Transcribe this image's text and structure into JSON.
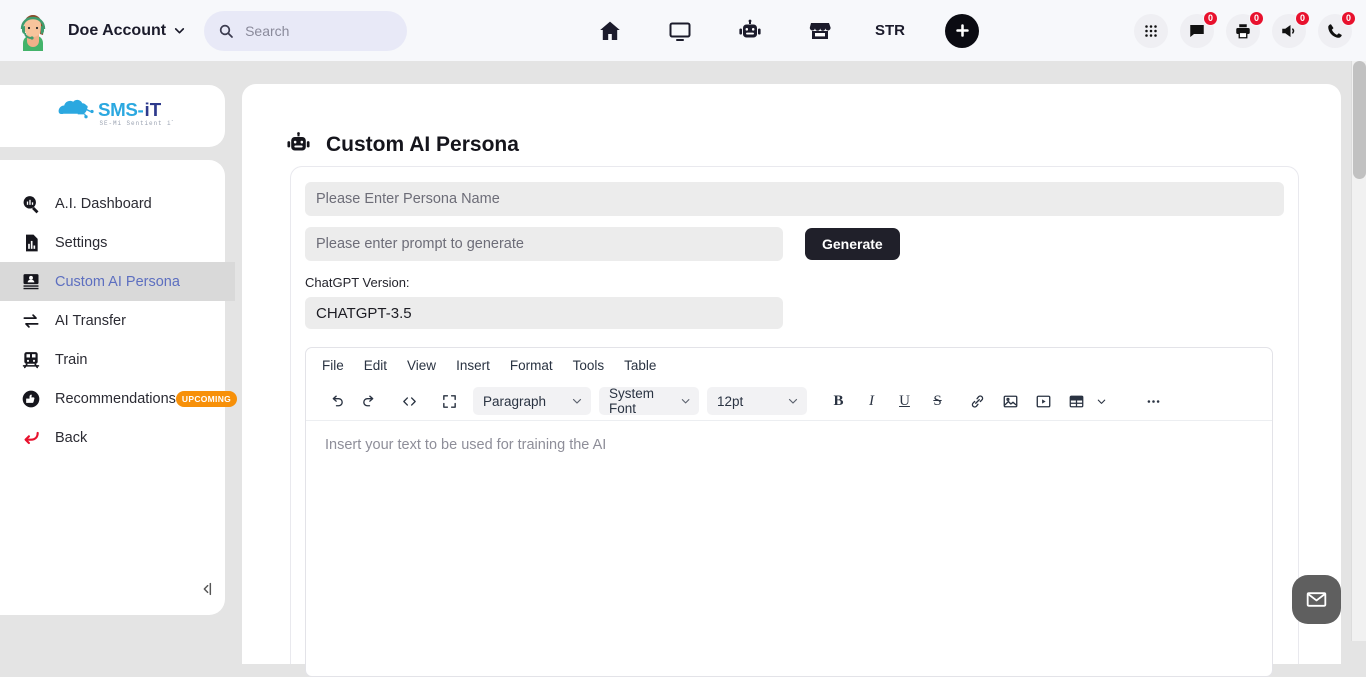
{
  "topbar": {
    "avatar": "user-avatar-headset",
    "account_name": "Doe Account",
    "account_chevron": "chevron-down-icon",
    "search": {
      "placeholder": "Search",
      "value": "",
      "icon": "search-icon"
    },
    "center_nav": [
      {
        "name": "home",
        "icon": "home-icon",
        "label": ""
      },
      {
        "name": "desktop",
        "icon": "monitor-icon",
        "label": ""
      },
      {
        "name": "ai-robot",
        "icon": "robot-icon",
        "label": ""
      },
      {
        "name": "store",
        "icon": "store-icon",
        "label": ""
      },
      {
        "name": "str",
        "icon": "",
        "label": "STR"
      }
    ],
    "add_button": {
      "icon": "plus-icon",
      "label": ""
    },
    "right_nav": [
      {
        "name": "apps",
        "icon": "grid-dots-icon",
        "badge": ""
      },
      {
        "name": "messages",
        "icon": "chat-bubble-icon",
        "badge": "0"
      },
      {
        "name": "fax",
        "icon": "printer-icon",
        "badge": "0"
      },
      {
        "name": "campaigns",
        "icon": "megaphone-icon",
        "badge": "0"
      },
      {
        "name": "calls",
        "icon": "phone-icon",
        "badge": "0"
      }
    ]
  },
  "sidebar": {
    "logo": {
      "title": "SMS-iT",
      "tagline": "SE-Mi Sentient iT"
    },
    "items": [
      {
        "label": "A.I. Dashboard",
        "icon": "dashboard-search-icon",
        "active": false,
        "badge": ""
      },
      {
        "label": "Settings",
        "icon": "report-settings-icon",
        "active": false,
        "badge": ""
      },
      {
        "label": "Custom AI Persona",
        "icon": "persona-card-icon",
        "active": true,
        "badge": ""
      },
      {
        "label": "AI Transfer",
        "icon": "transfer-arrows-icon",
        "active": false,
        "badge": ""
      },
      {
        "label": "Train",
        "icon": "train-icon",
        "active": false,
        "badge": ""
      },
      {
        "label": "Recommendations",
        "icon": "thumbs-up-icon",
        "active": false,
        "badge": "UPCOMING"
      },
      {
        "label": "Back",
        "icon": "back-arrow-icon",
        "active": false,
        "badge": ""
      }
    ],
    "collapse": {
      "icon": "collapse-sidebar-icon"
    }
  },
  "main": {
    "title": "Custom AI Persona",
    "title_icon": "robot-icon",
    "persona_name": {
      "placeholder": "Please Enter Persona Name",
      "value": ""
    },
    "prompt": {
      "placeholder": "Please enter prompt to generate",
      "value": ""
    },
    "generate_label": "Generate",
    "version_label": "ChatGPT Version:",
    "version_value": "CHATGPT-3.5",
    "editor": {
      "menus": [
        "File",
        "Edit",
        "View",
        "Insert",
        "Format",
        "Tools",
        "Table"
      ],
      "toolbar": {
        "undo": "undo-icon",
        "redo": "redo-icon",
        "source_code": "source-code-icon",
        "fullscreen": "fullscreen-icon",
        "block_format": "Paragraph",
        "font_family": "System Font",
        "font_size": "12pt",
        "bold": "B",
        "italic": "I",
        "underline": "U",
        "strikethrough": "S",
        "link": "link-icon",
        "image": "image-icon",
        "media": "media-icon",
        "table": "table-icon",
        "more": "more-options-icon"
      },
      "placeholder": "Insert your text to be used for training the AI"
    }
  },
  "fab": {
    "icon": "mail-icon",
    "label": ""
  },
  "colors": {
    "accent_blue": "#5d6fc0",
    "badge_red": "#e8112d",
    "upcoming_orange": "#f79009",
    "dark_button": "#20202a",
    "page_bg": "#e4e4e4"
  }
}
